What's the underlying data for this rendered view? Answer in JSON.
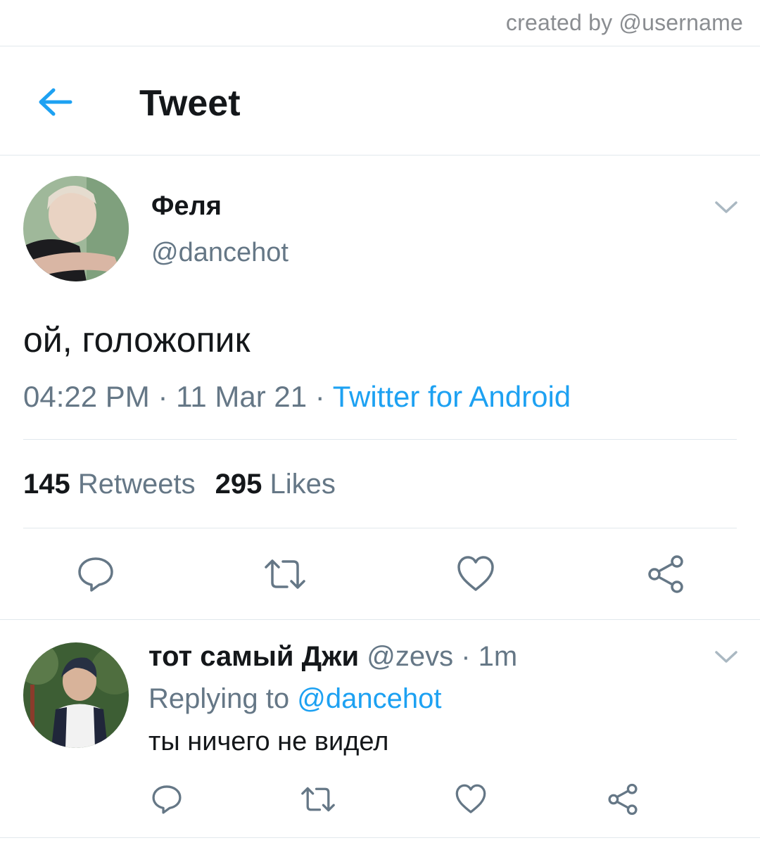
{
  "watermark": "created by @username",
  "header": {
    "title": "Tweet",
    "back_icon": "arrow-left-icon"
  },
  "tweet": {
    "display_name": "Феля",
    "handle": "@dancehot",
    "text": "ой, голожопик",
    "time": "04:22 PM",
    "dot1": " · ",
    "date": "11 Mar 21",
    "dot2": " · ",
    "source": "Twitter for Android",
    "retweets_count": "145",
    "retweets_label": "Retweets",
    "likes_count": "295",
    "likes_label": "Likes",
    "actions": [
      "reply-icon",
      "retweet-icon",
      "like-icon",
      "share-icon"
    ]
  },
  "reply": {
    "display_name": "тот самый Джи",
    "handle": "@zevs",
    "separator": " · ",
    "time": "1m",
    "replying_label": "Replying to ",
    "replying_to": "@dancehot",
    "text": "ты ничего не видел",
    "actions": [
      "reply-icon",
      "retweet-icon",
      "like-icon",
      "share-icon"
    ]
  },
  "colors": {
    "accent": "#1da1f2",
    "text_primary": "#14171a",
    "text_secondary": "#657786",
    "divider": "#e1e8ed"
  }
}
